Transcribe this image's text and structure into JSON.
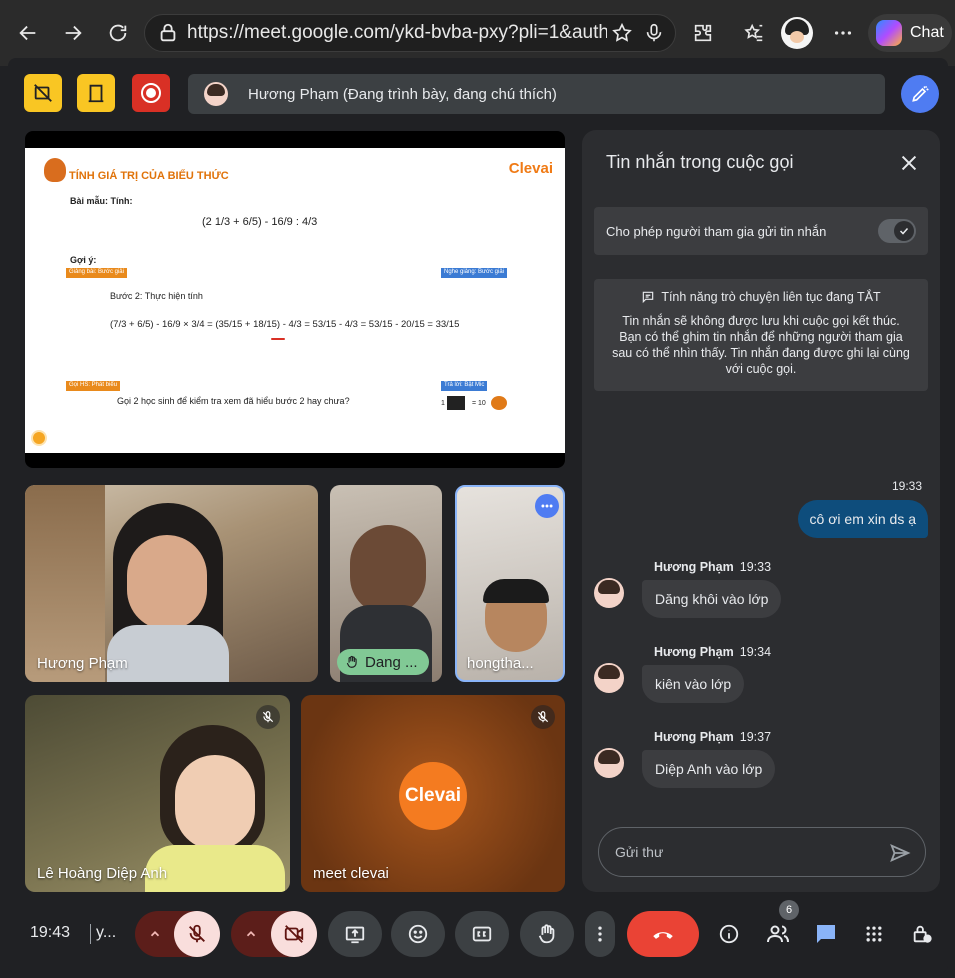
{
  "browser": {
    "url": "https://meet.google.com/ykd-bvba-pxy?pli=1&auth...",
    "chat_label": "Chat"
  },
  "top": {
    "presenter_text": "Hương Phạm (Đang trình bày, đang chú thích)"
  },
  "slide": {
    "title": "TÍNH GIÁ TRỊ CỦA BIỂU THỨC",
    "brand": "Clevai",
    "bai_mau": "Bài mẫu:  Tính:",
    "expr1": "(2 1/3 + 6/5) - 16/9 : 4/3",
    "goi_y": "Gợi ý:",
    "tag1": "Giảng bài: Bước giải",
    "tag2": "Nghe giảng: Bước giải",
    "step": "Bước 2: Thực hiện tính",
    "expr2": "(7/3 + 6/5) - 16/9 × 3/4 = (35/15 + 18/15) - 4/3 = 53/15 - 4/3 = 53/15 - 20/15 = 33/15",
    "tag3": "Gọi HS: Phát biểu",
    "tag4": "Trả lời: Bật Mic",
    "question": "Gọi 2 học sinh để kiểm tra xem đã hiểu bước 2 hay chưa?",
    "reward_left": "1",
    "reward_right": "= 10"
  },
  "tiles": {
    "t1": "Hương Phạm",
    "t2": "Dang ...",
    "t3": "hongtha...",
    "t4": "Lê Hoàng Diệp Anh",
    "t5": "meet clevai",
    "clevai_logo": "Clevai"
  },
  "chat": {
    "title": "Tin nhắn trong cuộc gọi",
    "toggle_label": "Cho phép người tham gia gửi tin nhắn",
    "info_title": "Tính năng trò chuyện liên tục đang TẮT",
    "info_body": "Tin nhắn sẽ không được lưu khi cuộc gọi kết thúc. Bạn có thể ghim tin nhắn để những người tham gia sau có thể nhìn thấy. Tin nhắn đang được ghi lại cùng với cuộc gọi.",
    "self_time": "19:33",
    "self_msg": "cô ơi em xin ds ạ",
    "messages": [
      {
        "sender": "Hương Phạm",
        "time": "19:33",
        "text": "Dăng khôi vào lớp"
      },
      {
        "sender": "Hương Phạm",
        "time": "19:34",
        "text": "kiên vào lớp"
      },
      {
        "sender": "Hương Phạm",
        "time": "19:37",
        "text": "Diệp Anh vào lớp"
      }
    ],
    "input_placeholder": "Gửi thư"
  },
  "controls": {
    "clock": "19:43",
    "room": "y...",
    "participants_count": "6"
  },
  "colors": {
    "accent_yellow": "#f9c623",
    "record_red": "#d93025",
    "end_call": "#ea4335",
    "self_bubble": "#0e4d7c",
    "chat_blue": "#8ab4f8"
  }
}
